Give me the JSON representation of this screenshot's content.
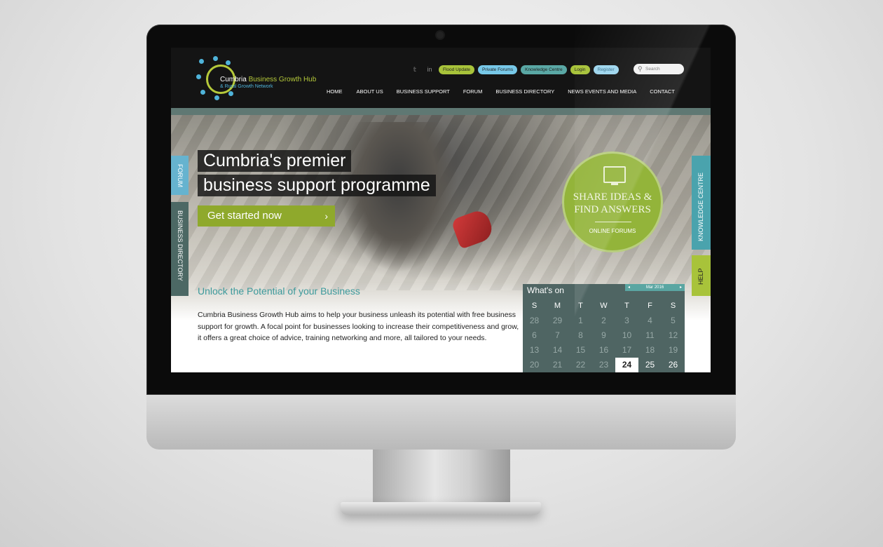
{
  "site": {
    "logo": {
      "line1_white": "Cumbria",
      "line1_green": "Business Growth Hub",
      "line2": "& Rural Growth Network"
    },
    "social": [
      "twitter-icon",
      "linkedin-icon"
    ],
    "social_labels": {
      "twitter": "𝕥",
      "linkedin": "in"
    },
    "utility_links": [
      "Flood Update",
      "Private Forums",
      "Knowledge Centre",
      "Login",
      "Register"
    ],
    "search_placeholder": "Search",
    "nav": [
      "HOME",
      "ABOUT US",
      "BUSINESS SUPPORT",
      "FORUM",
      "BUSINESS DIRECTORY",
      "NEWS EVENTS AND MEDIA",
      "CONTACT"
    ]
  },
  "hero": {
    "headline_line1": "Cumbria's premier",
    "headline_line2": "business support programme",
    "cta": "Get started now",
    "cta_chevron": "›",
    "circle_line1": "SHARE IDEAS &",
    "circle_line2": "FIND ANSWERS",
    "circle_sub": "ONLINE FORUMS"
  },
  "side_tabs": {
    "forum": "FORUM",
    "business_directory": "BUSINESS DIRECTORY",
    "knowledge_centre": "KNOWLEDGE CENTRE",
    "help": "HELP"
  },
  "intro": {
    "heading": "Unlock the Potential of your Business",
    "body": "Cumbria Business Growth Hub aims to help your business unleash its potential with free business support for growth. A focal point for businesses looking to increase their competitiveness and grow, it offers a great choice of advice, training networking and more, all tailored to your needs."
  },
  "calendar": {
    "title": "What's on",
    "month": "Mar 2016",
    "prev": "◂",
    "next": "▸",
    "weekdays": [
      "S",
      "M",
      "T",
      "W",
      "T",
      "F",
      "S"
    ],
    "days": [
      {
        "d": "28",
        "s": "past"
      },
      {
        "d": "29",
        "s": "past"
      },
      {
        "d": "1",
        "s": "past"
      },
      {
        "d": "2",
        "s": "past"
      },
      {
        "d": "3",
        "s": "past"
      },
      {
        "d": "4",
        "s": "past"
      },
      {
        "d": "5",
        "s": "past"
      },
      {
        "d": "6",
        "s": "past"
      },
      {
        "d": "7",
        "s": "past"
      },
      {
        "d": "8",
        "s": "past"
      },
      {
        "d": "9",
        "s": "past"
      },
      {
        "d": "10",
        "s": "past"
      },
      {
        "d": "11",
        "s": "past"
      },
      {
        "d": "12",
        "s": "past"
      },
      {
        "d": "13",
        "s": "past"
      },
      {
        "d": "14",
        "s": "past"
      },
      {
        "d": "15",
        "s": "past"
      },
      {
        "d": "16",
        "s": "past"
      },
      {
        "d": "17",
        "s": "past"
      },
      {
        "d": "18",
        "s": "past"
      },
      {
        "d": "19",
        "s": "past"
      },
      {
        "d": "20",
        "s": "past"
      },
      {
        "d": "21",
        "s": "past"
      },
      {
        "d": "22",
        "s": "past"
      },
      {
        "d": "23",
        "s": "past"
      },
      {
        "d": "24",
        "s": "today"
      },
      {
        "d": "25",
        "s": "cur"
      },
      {
        "d": "26",
        "s": "cur"
      }
    ]
  },
  "colors": {
    "brand_green": "#8fa92c",
    "brand_teal": "#4aa3ad",
    "brand_blue": "#66b3cf",
    "calendar_bg": "#4f6563"
  }
}
